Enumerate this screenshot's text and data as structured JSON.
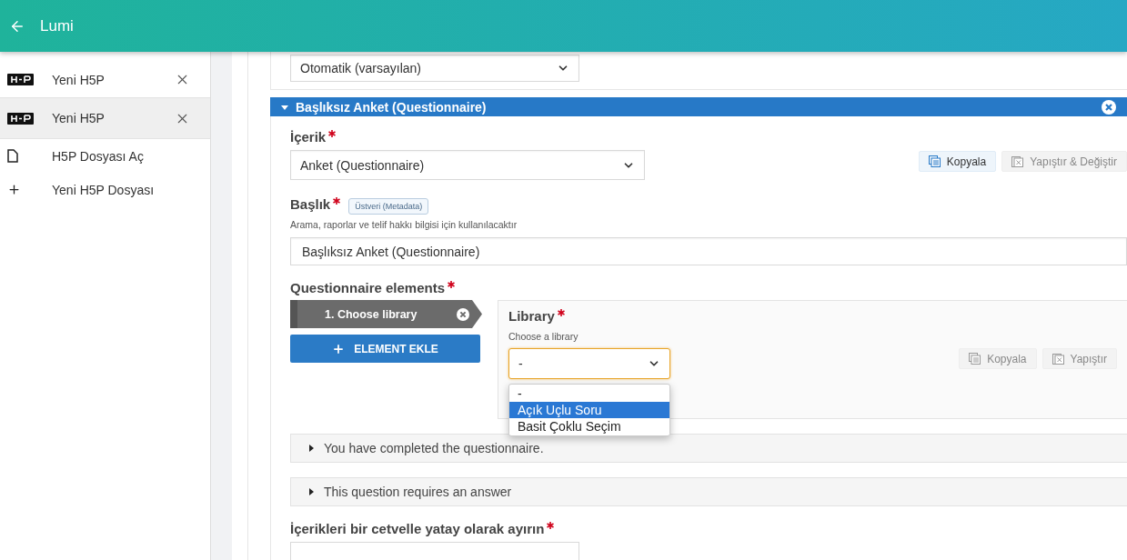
{
  "app_bar": {
    "title": "Lumi"
  },
  "sidebar": {
    "items": [
      {
        "kind": "tab",
        "label": "Yeni H5P",
        "selected": false
      },
      {
        "kind": "tab",
        "label": "Yeni H5P",
        "selected": true
      },
      {
        "kind": "open",
        "label": "H5P Dosyası Aç"
      },
      {
        "kind": "new",
        "label": "Yeni H5P Dosyası"
      }
    ]
  },
  "editor": {
    "top_select": {
      "value": "Otomatik (varsayılan)"
    },
    "section": {
      "title": "Başlıksız Anket (Questionnaire)",
      "expanded": true,
      "content_field": {
        "label": "İçerik",
        "required": true,
        "value": "Anket (Questionnaire)"
      },
      "copy_button": {
        "label": "Kopyala",
        "disabled": false
      },
      "paste_button": {
        "label": "Yapıştır & Değiştir",
        "disabled": true
      },
      "title_field": {
        "label": "Başlık",
        "required": true,
        "badge": "Üstveri (Metadata)",
        "description": "Arama, raporlar ve telif hakkı bilgisi için kullanılacaktır",
        "value": "Başlıksız Anket (Questionnaire)"
      },
      "elements": {
        "label": "Questionnaire elements",
        "required": true,
        "items": [
          {
            "label": "1. Choose library",
            "selected": true
          }
        ],
        "add_button": "ELEMENT EKLE",
        "library": {
          "label": "Library",
          "required": true,
          "description": "Choose a library",
          "value": "-",
          "options": [
            {
              "label": "-",
              "highlighted": false
            },
            {
              "label": "Açık Uçlu Soru",
              "highlighted": true
            },
            {
              "label": "Basit Çoklu Seçim",
              "highlighted": false
            }
          ],
          "copy_button": {
            "label": "Kopyala",
            "disabled": true
          },
          "paste_button": {
            "label": "Yapıştır",
            "disabled": true
          }
        }
      },
      "groups": [
        {
          "label": "You have completed the questionnaire.",
          "expanded": false
        },
        {
          "label": "This question requires an answer",
          "expanded": false
        }
      ],
      "separator_field": {
        "label": "İçerikleri bir cetvelle yatay olarak ayırın",
        "required": true
      }
    }
  }
}
